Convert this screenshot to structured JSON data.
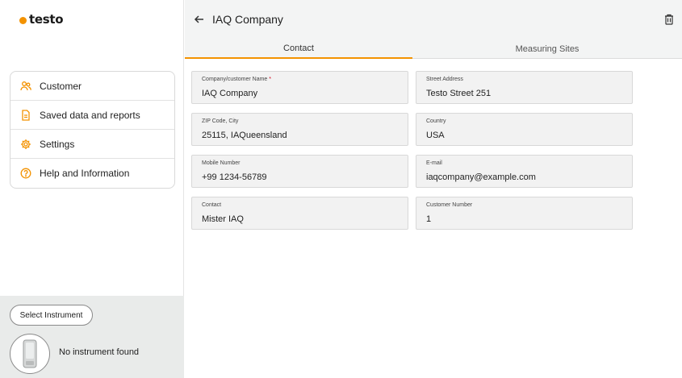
{
  "brand": {
    "logo_text": "testo",
    "accent_color": "#f39200"
  },
  "sidebar": {
    "items": [
      {
        "label": "Customer",
        "icon": "users-icon"
      },
      {
        "label": "Saved data and reports",
        "icon": "document-icon"
      },
      {
        "label": "Settings",
        "icon": "gear-icon"
      },
      {
        "label": "Help and Information",
        "icon": "help-icon"
      }
    ],
    "instrument": {
      "select_label": "Select Instrument",
      "status": "No instrument found"
    }
  },
  "header": {
    "title": "IAQ Company"
  },
  "tabs": [
    {
      "label": "Contact",
      "active": true
    },
    {
      "label": "Measuring Sites",
      "active": false
    }
  ],
  "form": {
    "company": {
      "label": "Company/customer Name",
      "required_mark": "*",
      "value": "IAQ Company"
    },
    "street": {
      "label": "Street Address",
      "value": "Testo Street 251"
    },
    "zip_city": {
      "label": "ZIP Code, City",
      "value": "25115, IAQueensland"
    },
    "country": {
      "label": "Country",
      "value": "USA"
    },
    "mobile": {
      "label": "Mobile Number",
      "value": "+99 1234-56789"
    },
    "email": {
      "label": "E-mail",
      "value": "iaqcompany@example.com"
    },
    "contact": {
      "label": "Contact",
      "value": "Mister IAQ"
    },
    "customer_number": {
      "label": "Customer Number",
      "value": "1"
    }
  }
}
